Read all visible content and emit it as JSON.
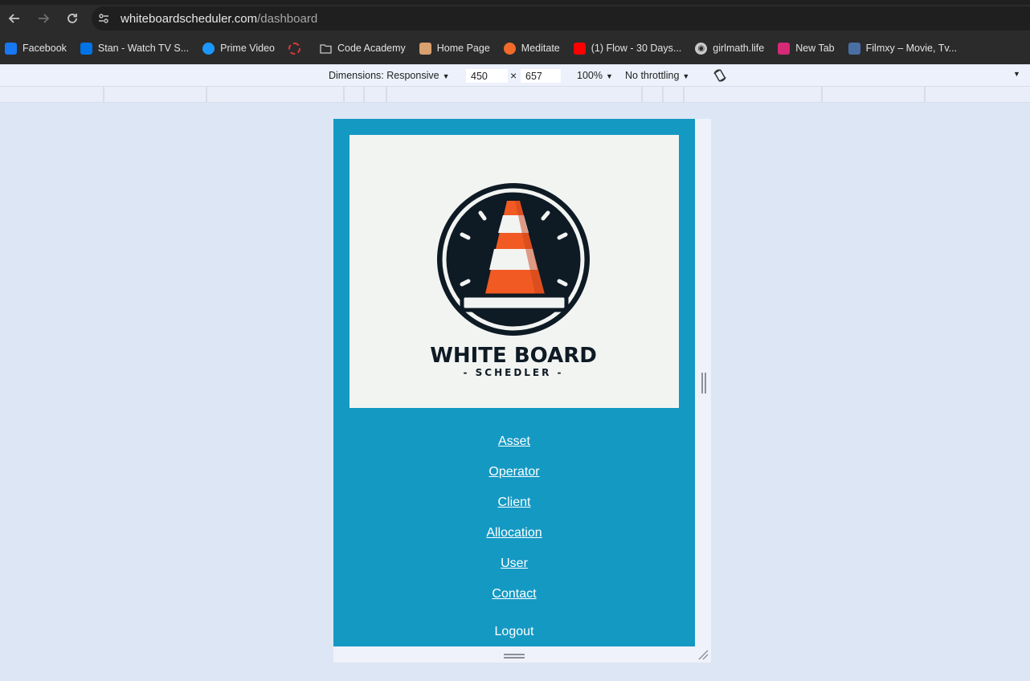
{
  "browser": {
    "url_host": "whiteboardscheduler.com",
    "url_path": "/dashboard",
    "bookmarks": [
      {
        "label": "Facebook",
        "icon": "facebook-icon",
        "color": "#1877f2"
      },
      {
        "label": "Stan - Watch TV S...",
        "icon": "stan-icon",
        "color": "#0073e6"
      },
      {
        "label": "Prime Video",
        "icon": "prime-video-icon",
        "color": "#1a98ff"
      },
      {
        "label": "",
        "icon": "loading-circle-icon",
        "color": "#e03a3a"
      },
      {
        "label": "Code Academy",
        "icon": "folder-icon",
        "color": "#c9c9c9"
      },
      {
        "label": "Home Page",
        "icon": "avatar-icon",
        "color": "#d9a070"
      },
      {
        "label": "Meditate",
        "icon": "meditate-icon",
        "color": "#f26a2a"
      },
      {
        "label": "(1) Flow - 30 Days...",
        "icon": "youtube-icon",
        "color": "#ff0000"
      },
      {
        "label": "girlmath.life",
        "icon": "globe-icon",
        "color": "#c9c9c9"
      },
      {
        "label": "New Tab",
        "icon": "instagram-icon",
        "color": "#d62976"
      },
      {
        "label": "Filmxy – Movie, Tv...",
        "icon": "filmxy-icon",
        "color": "#4a6fa5"
      }
    ]
  },
  "devtools": {
    "dimensions_label": "Dimensions: Responsive",
    "width": "450",
    "times": "×",
    "height": "657",
    "zoom": "100%",
    "throttling": "No throttling"
  },
  "app": {
    "logo_title": "WHITE BOARD",
    "logo_subtitle": "- SCHEDLER -",
    "nav": [
      "Asset",
      "Operator",
      "Client",
      "Allocation",
      "User",
      "Contact"
    ],
    "logout": "Logout",
    "colors": {
      "background": "#1499c3",
      "cone": "#f15a22",
      "ring": "#0e1a24"
    }
  }
}
